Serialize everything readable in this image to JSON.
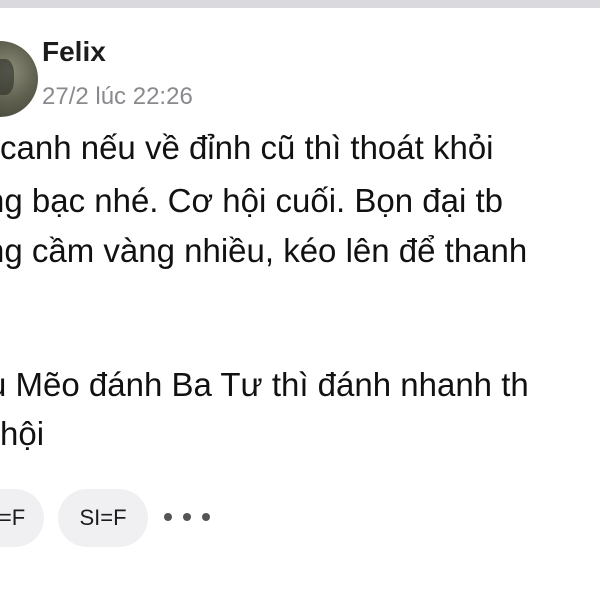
{
  "post": {
    "author": "Felix",
    "timestamp": "27/2 lúc 22:26",
    "lines": [
      "canh nếu về đỉnh cũ thì thoát khỏi",
      "ng bạc nhé. Cơ hội cuối. Bọn đại tb",
      "ng cầm vàng nhiều, kéo lên để thanh",
      "u Mẽo đánh Ba Tư thì đánh nhanh th",
      "hội"
    ]
  },
  "reactions": {
    "chip1_label": "=F",
    "chip2_label": "SI=F",
    "more_icon": "more-horizontal-icon"
  },
  "colors": {
    "text": "#111111",
    "meta": "#8a8a8e",
    "chip_bg": "#f0f0f2"
  }
}
